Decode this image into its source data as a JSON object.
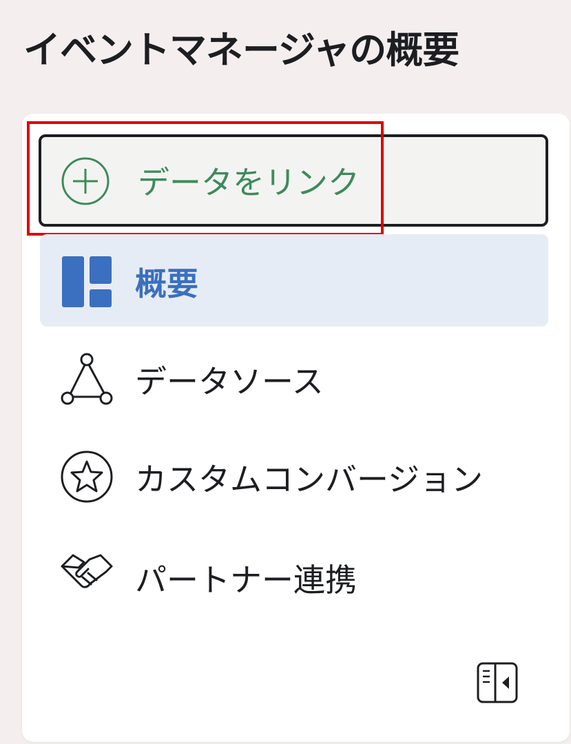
{
  "header": {
    "title": "イベントマネージャの概要"
  },
  "sidebar": {
    "link_data_button": {
      "label": "データをリンク",
      "icon": "plus-circle-icon"
    },
    "items": [
      {
        "label": "概要",
        "icon": "overview-grid-icon",
        "active": true
      },
      {
        "label": "データソース",
        "icon": "data-sources-icon",
        "active": false
      },
      {
        "label": "カスタムコンバージョン",
        "icon": "star-badge-icon",
        "active": false
      },
      {
        "label": "パートナー連携",
        "icon": "handshake-icon",
        "active": false
      }
    ],
    "collapse_icon": "collapse-sidebar-icon"
  },
  "colors": {
    "accent_green": "#3e8a5b",
    "active_blue": "#3b6fbf",
    "active_bg": "#e6ecf5",
    "highlight_red": "#e00000"
  }
}
